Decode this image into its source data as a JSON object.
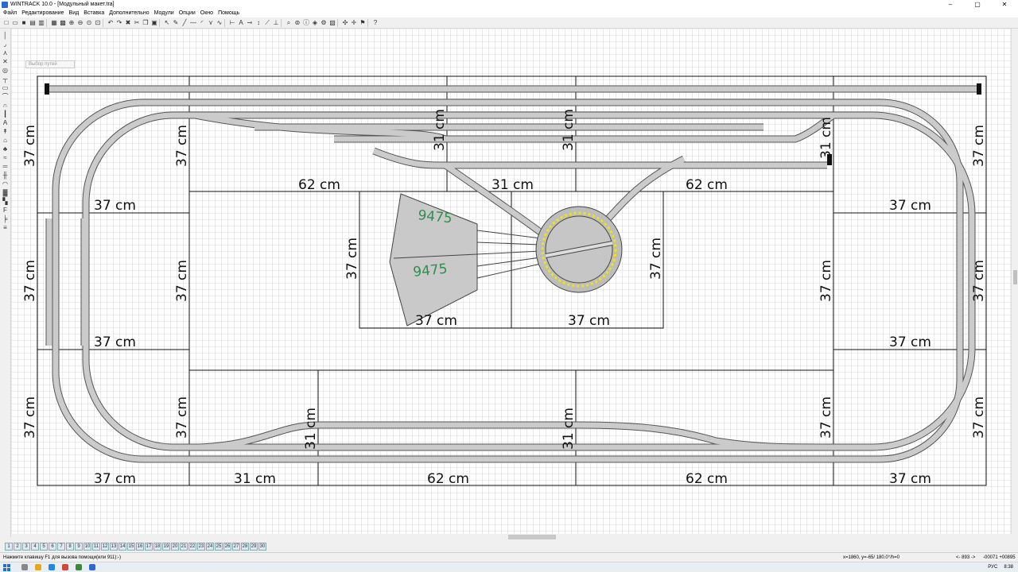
{
  "window": {
    "title": "WINTRACK 10.0 - [Модульный макет.tra]"
  },
  "menu": [
    "Файл",
    "Редактирование",
    "Вид",
    "Вставка",
    "Дополнительно",
    "Модули",
    "Опции",
    "Окно",
    "Помощь"
  ],
  "search": {
    "placeholder": "Выбор путей"
  },
  "layout": {
    "labels": {
      "left_top": "37 cm",
      "left_mid": "37 cm",
      "left_bot": "37 cm",
      "innerleft_top": "37 cm",
      "innerleft_mid": "37 cm",
      "innerleft_bot": "37 cm",
      "right_top": "37 cm",
      "right_mid": "37 cm",
      "right_bot": "37 cm",
      "innerright_top": "31 cm",
      "innerright_mid": "37 cm",
      "innerright_bot": "37 cm",
      "top_62_left": "62 cm",
      "top_31": "31 cm",
      "top_62_right": "62 cm",
      "left_37_a": "37 cm",
      "left_37_b": "37 cm",
      "right_37_a": "37 cm",
      "right_37_b": "37 cm",
      "center_37_left": "37 cm",
      "center_37_right": "37 cm",
      "center_37_bottom_left": "37 cm",
      "center_37_bottom_right": "37 cm",
      "bottom_37_left": "37 cm",
      "bottom_31": "31 cm",
      "bottom_62_left": "62 cm",
      "bottom_62_right": "62 cm",
      "bottom_37_right": "37 cm",
      "bottom_vert_31a": "31 cm",
      "bottom_vert_31b": "31 cm",
      "top_vert_31a": "31 cm",
      "top_vert_31b": "31 cm",
      "turntable_label_a": "9475",
      "turntable_label_b": "9475"
    }
  },
  "layers": [
    "1",
    "2",
    "3",
    "4",
    "5",
    "6",
    "7",
    "8",
    "9",
    "10",
    "11",
    "12",
    "13",
    "14",
    "15",
    "16",
    "17",
    "18",
    "19",
    "20",
    "21",
    "22",
    "23",
    "24",
    "25",
    "26",
    "27",
    "28",
    "29",
    "30"
  ],
  "status": {
    "help": "Нажмите клавишу F1 для вызова помощи(или 911):-)",
    "coords": "x=1860, y=-65/ 180.0°/h=0",
    "zoom": "<- 893 ->",
    "pos": "-00071 +00895"
  },
  "tray": {
    "lang": "РУС",
    "time": "8:38"
  },
  "colors": {
    "track": "#c8c8c8",
    "track_edge": "#555555",
    "label_green": "#2f8f4f",
    "turntable_yellow": "#f2e600"
  }
}
